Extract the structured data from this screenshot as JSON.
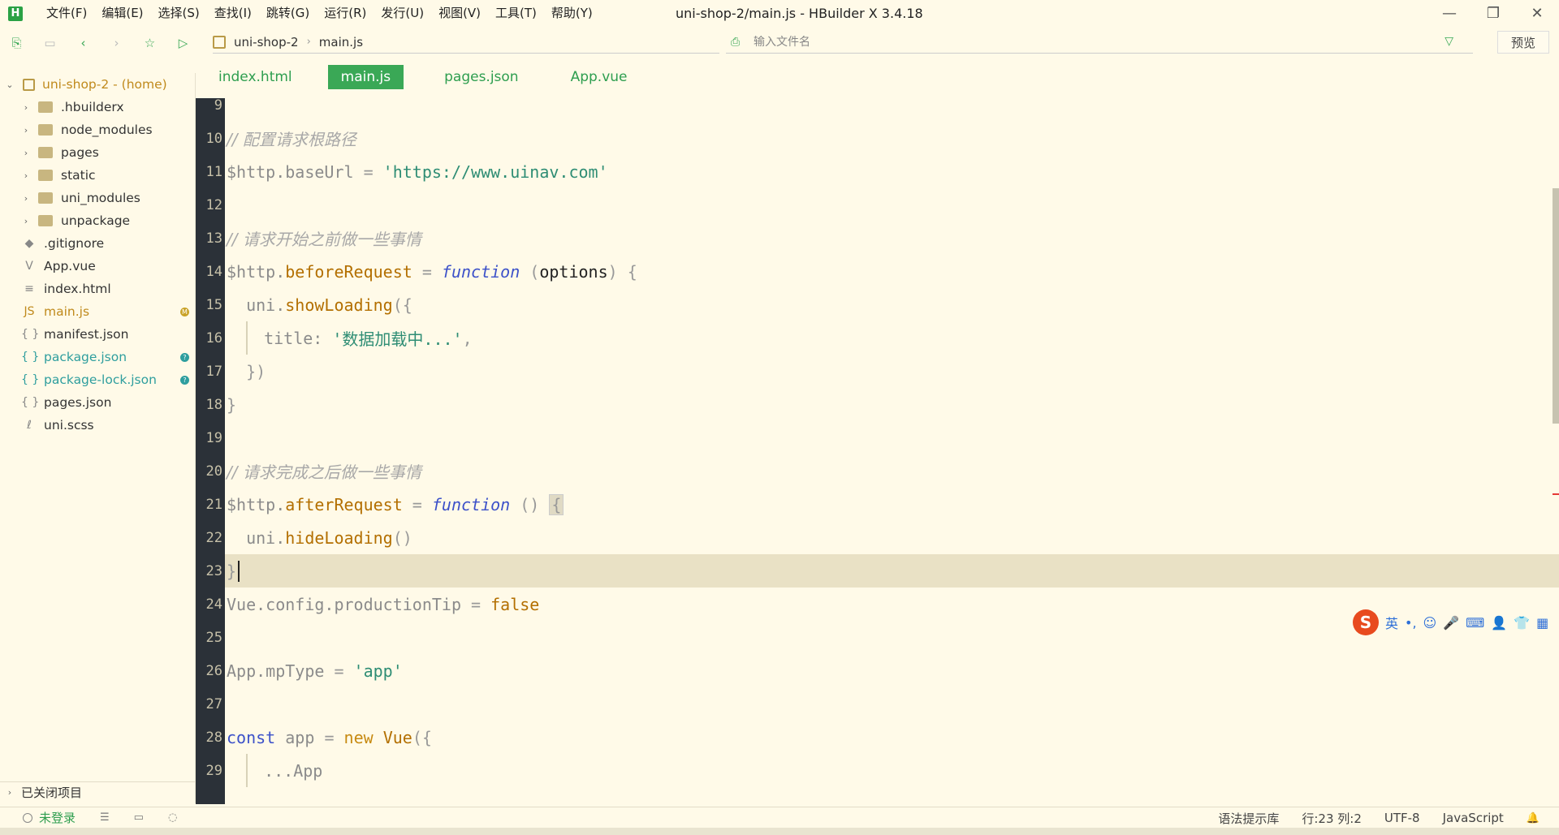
{
  "window": {
    "title": "uni-shop-2/main.js - HBuilder X 3.4.18",
    "logo": "H",
    "minimize": "—",
    "restore": "❐",
    "close": "✕"
  },
  "menu": [
    "文件(F)",
    "编辑(E)",
    "选择(S)",
    "查找(I)",
    "跳转(G)",
    "运行(R)",
    "发行(U)",
    "视图(V)",
    "工具(T)",
    "帮助(Y)"
  ],
  "toolbar": {
    "breadcrumb": [
      "uni-shop-2",
      "main.js"
    ],
    "file_search_placeholder": "输入文件名",
    "preview_label": "预览"
  },
  "sidebar": {
    "project": "uni-shop-2 - (home)",
    "folders": [
      ".hbuilderx",
      "node_modules",
      "pages",
      "static",
      "uni_modules",
      "unpackage"
    ],
    "files": [
      {
        "name": ".gitignore",
        "icon": "git-icon",
        "glyph": "◆",
        "color": "#333333"
      },
      {
        "name": "App.vue",
        "icon": "vue-icon",
        "glyph": "V",
        "color": "#333333"
      },
      {
        "name": "index.html",
        "icon": "html-file-icon",
        "glyph": "≡",
        "color": "#333333"
      },
      {
        "name": "main.js",
        "icon": "js-icon",
        "glyph": "JS",
        "color": "#c08a1c",
        "badge": "M",
        "badge_color": "#c9a227"
      },
      {
        "name": "manifest.json",
        "icon": "json-icon",
        "glyph": "{ }",
        "color": "#333333"
      },
      {
        "name": "package.json",
        "icon": "json-icon",
        "glyph": "{ }",
        "color": "#2e9e9e",
        "badge": "?",
        "badge_color": "#2e9e9e"
      },
      {
        "name": "package-lock.json",
        "icon": "json-icon",
        "glyph": "{ }",
        "color": "#2e9e9e",
        "badge": "?",
        "badge_color": "#2e9e9e"
      },
      {
        "name": "pages.json",
        "icon": "json-icon",
        "glyph": "{ }",
        "color": "#333333"
      },
      {
        "name": "uni.scss",
        "icon": "scss-icon",
        "glyph": "ℓ",
        "color": "#333333"
      }
    ],
    "closed_projects": "已关闭项目"
  },
  "tabs": [
    {
      "label": "index.html",
      "active": false
    },
    {
      "label": "main.js",
      "active": true
    },
    {
      "label": "pages.json",
      "active": false
    },
    {
      "label": "App.vue",
      "active": false
    }
  ],
  "editor": {
    "lines": [
      {
        "n": "9",
        "parts": []
      },
      {
        "n": "10",
        "parts": [
          {
            "t": "// 配置请求根路径",
            "c": "c-comment"
          }
        ]
      },
      {
        "n": "11",
        "parts": [
          {
            "t": "$http.baseUrl",
            "c": "c-ident"
          },
          {
            "t": " = ",
            "c": "c-op"
          },
          {
            "t": "'https://www.uinav.com'",
            "c": "c-string"
          }
        ]
      },
      {
        "n": "12",
        "parts": []
      },
      {
        "n": "13",
        "parts": [
          {
            "t": "// 请求开始之前做一些事情",
            "c": "c-comment"
          }
        ]
      },
      {
        "n": "14",
        "parts": [
          {
            "t": "$http.",
            "c": "c-ident"
          },
          {
            "t": "beforeRequest",
            "c": "c-method"
          },
          {
            "t": " = ",
            "c": "c-op"
          },
          {
            "t": "function",
            "c": "c-keyword"
          },
          {
            "t": " (",
            "c": "c-op"
          },
          {
            "t": "options",
            "c": "c-plain"
          },
          {
            "t": ") {",
            "c": "c-op"
          }
        ]
      },
      {
        "n": "15",
        "indent": 1,
        "parts": [
          {
            "t": "uni.",
            "c": "c-ident"
          },
          {
            "t": "showLoading",
            "c": "c-method"
          },
          {
            "t": "({",
            "c": "c-op"
          }
        ]
      },
      {
        "n": "16",
        "indent": 2,
        "parts": [
          {
            "t": "title: ",
            "c": "c-ident"
          },
          {
            "t": "'数据加载中...'",
            "c": "c-string"
          },
          {
            "t": ",",
            "c": "c-op"
          }
        ]
      },
      {
        "n": "17",
        "indent": 1,
        "parts": [
          {
            "t": "})",
            "c": "c-op"
          }
        ]
      },
      {
        "n": "18",
        "parts": [
          {
            "t": "}",
            "c": "c-op"
          }
        ]
      },
      {
        "n": "19",
        "parts": []
      },
      {
        "n": "20",
        "parts": [
          {
            "t": "// 请求完成之后做一些事情",
            "c": "c-comment"
          }
        ]
      },
      {
        "n": "21",
        "parts": [
          {
            "t": "$http.",
            "c": "c-ident"
          },
          {
            "t": "afterRequest",
            "c": "c-method"
          },
          {
            "t": " = ",
            "c": "c-op"
          },
          {
            "t": "function",
            "c": "c-keyword"
          },
          {
            "t": " () ",
            "c": "c-op"
          },
          {
            "t": "{",
            "c": "c-op hl-brace"
          }
        ]
      },
      {
        "n": "22",
        "indent": 1,
        "parts": [
          {
            "t": "uni.",
            "c": "c-ident"
          },
          {
            "t": "hideLoading",
            "c": "c-method"
          },
          {
            "t": "()",
            "c": "c-op"
          }
        ]
      },
      {
        "n": "23",
        "current": true,
        "parts": [
          {
            "t": "}",
            "c": "c-op"
          }
        ]
      },
      {
        "n": "24",
        "parts": [
          {
            "t": "Vue.config.productionTip",
            "c": "c-ident"
          },
          {
            "t": " = ",
            "c": "c-op"
          },
          {
            "t": "false",
            "c": "c-bool"
          }
        ]
      },
      {
        "n": "25",
        "parts": []
      },
      {
        "n": "26",
        "parts": [
          {
            "t": "App.mpType",
            "c": "c-ident"
          },
          {
            "t": " = ",
            "c": "c-op"
          },
          {
            "t": "'app'",
            "c": "c-string"
          }
        ]
      },
      {
        "n": "27",
        "parts": []
      },
      {
        "n": "28",
        "parts": [
          {
            "t": "const",
            "c": "c-const"
          },
          {
            "t": " app ",
            "c": "c-ident"
          },
          {
            "t": "= ",
            "c": "c-op"
          },
          {
            "t": "new",
            "c": "c-new"
          },
          {
            "t": " Vue",
            "c": "c-vue"
          },
          {
            "t": "({",
            "c": "c-op"
          }
        ]
      },
      {
        "n": "29",
        "indent": 2,
        "parts": [
          {
            "t": "...App",
            "c": "c-ident"
          }
        ]
      }
    ]
  },
  "ime": {
    "logo": "S",
    "items": [
      "英",
      "•,",
      "☺",
      "🎤",
      "⌨",
      "👤",
      "👕",
      "▦"
    ]
  },
  "statusbar": {
    "login": "未登录",
    "syntax_lib": "语法提示库",
    "position": "行:23  列:2",
    "encoding": "UTF-8",
    "language": "JavaScript"
  }
}
